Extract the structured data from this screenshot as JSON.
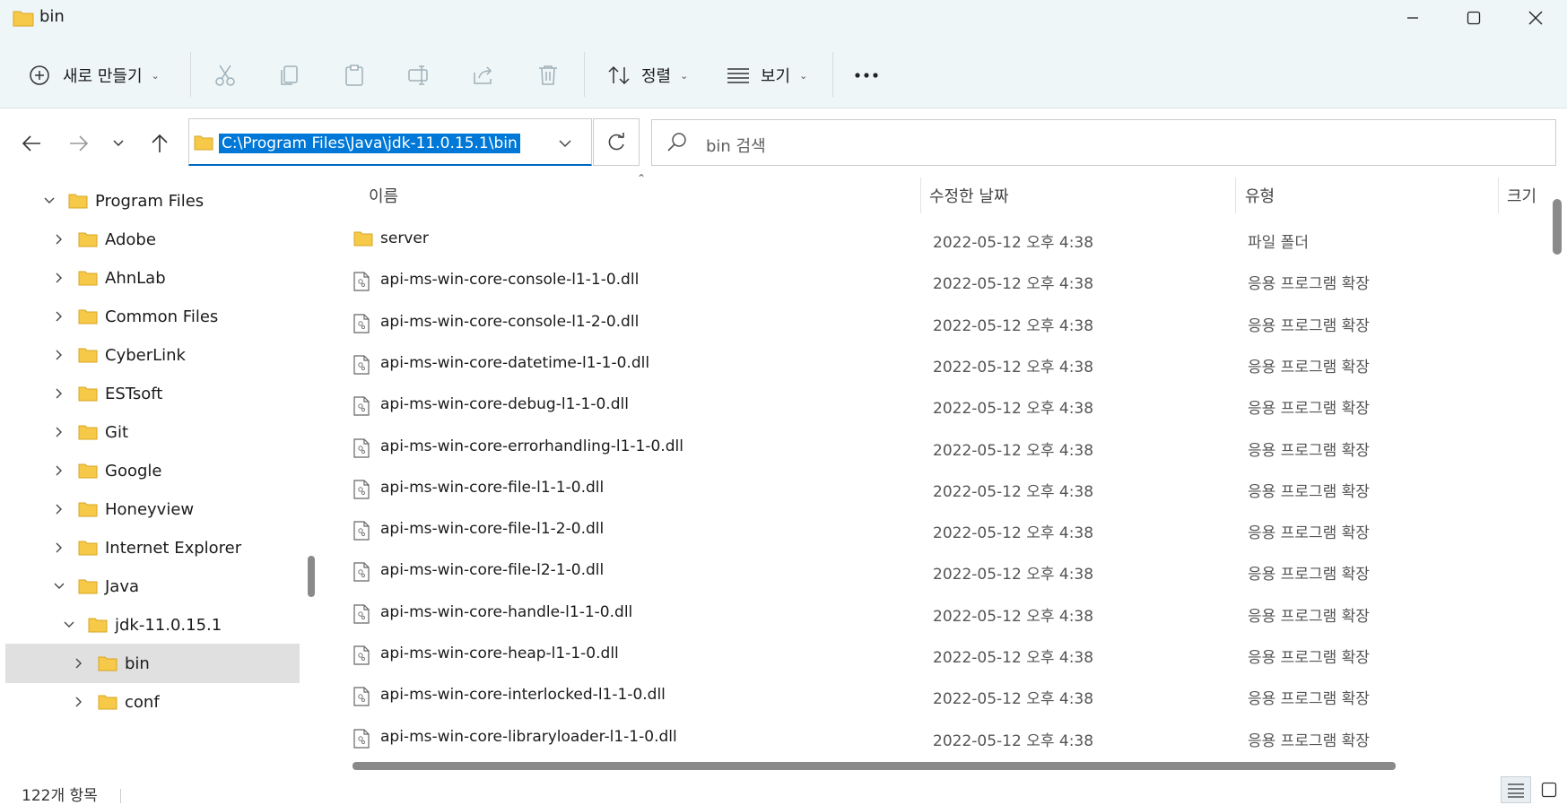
{
  "window": {
    "title": "bin"
  },
  "commandbar": {
    "new_label": "새로 만들기",
    "sort_label": "정렬",
    "view_label": "보기"
  },
  "address": {
    "path": "C:\\Program Files\\Java\\jdk-11.0.15.1\\bin",
    "search_placeholder": "bin 검색"
  },
  "sidebar": {
    "items": [
      {
        "label": "Program Files",
        "state": "expanded"
      },
      {
        "label": "Adobe",
        "state": "collapsed"
      },
      {
        "label": "AhnLab",
        "state": "collapsed"
      },
      {
        "label": "Common Files",
        "state": "collapsed"
      },
      {
        "label": "CyberLink",
        "state": "collapsed"
      },
      {
        "label": "ESTsoft",
        "state": "collapsed"
      },
      {
        "label": "Git",
        "state": "collapsed"
      },
      {
        "label": "Google",
        "state": "collapsed"
      },
      {
        "label": "Honeyview",
        "state": "collapsed"
      },
      {
        "label": "Internet Explorer",
        "state": "collapsed"
      },
      {
        "label": "Java",
        "state": "expanded"
      },
      {
        "label": "jdk-11.0.15.1",
        "state": "expanded"
      },
      {
        "label": "bin",
        "state": "selected"
      },
      {
        "label": "conf",
        "state": "collapsed"
      }
    ]
  },
  "list": {
    "columns": {
      "name": "이름",
      "modified": "수정한 날짜",
      "type": "유형",
      "size": "크기"
    },
    "rows": [
      {
        "name": "server",
        "modified": "2022-05-12 오후 4:38",
        "type": "파일 폴더",
        "kind": "folder"
      },
      {
        "name": "api-ms-win-core-console-l1-1-0.dll",
        "modified": "2022-05-12 오후 4:38",
        "type": "응용 프로그램 확장",
        "kind": "dll"
      },
      {
        "name": "api-ms-win-core-console-l1-2-0.dll",
        "modified": "2022-05-12 오후 4:38",
        "type": "응용 프로그램 확장",
        "kind": "dll"
      },
      {
        "name": "api-ms-win-core-datetime-l1-1-0.dll",
        "modified": "2022-05-12 오후 4:38",
        "type": "응용 프로그램 확장",
        "kind": "dll"
      },
      {
        "name": "api-ms-win-core-debug-l1-1-0.dll",
        "modified": "2022-05-12 오후 4:38",
        "type": "응용 프로그램 확장",
        "kind": "dll"
      },
      {
        "name": "api-ms-win-core-errorhandling-l1-1-0.dll",
        "modified": "2022-05-12 오후 4:38",
        "type": "응용 프로그램 확장",
        "kind": "dll"
      },
      {
        "name": "api-ms-win-core-file-l1-1-0.dll",
        "modified": "2022-05-12 오후 4:38",
        "type": "응용 프로그램 확장",
        "kind": "dll"
      },
      {
        "name": "api-ms-win-core-file-l1-2-0.dll",
        "modified": "2022-05-12 오후 4:38",
        "type": "응용 프로그램 확장",
        "kind": "dll"
      },
      {
        "name": "api-ms-win-core-file-l2-1-0.dll",
        "modified": "2022-05-12 오후 4:38",
        "type": "응용 프로그램 확장",
        "kind": "dll"
      },
      {
        "name": "api-ms-win-core-handle-l1-1-0.dll",
        "modified": "2022-05-12 오후 4:38",
        "type": "응용 프로그램 확장",
        "kind": "dll"
      },
      {
        "name": "api-ms-win-core-heap-l1-1-0.dll",
        "modified": "2022-05-12 오후 4:38",
        "type": "응용 프로그램 확장",
        "kind": "dll"
      },
      {
        "name": "api-ms-win-core-interlocked-l1-1-0.dll",
        "modified": "2022-05-12 오후 4:38",
        "type": "응용 프로그램 확장",
        "kind": "dll"
      },
      {
        "name": "api-ms-win-core-libraryloader-l1-1-0.dll",
        "modified": "2022-05-12 오후 4:38",
        "type": "응용 프로그램 확장",
        "kind": "dll"
      }
    ]
  },
  "status": {
    "item_count": "122개 항목"
  },
  "colors": {
    "accent": "#0078d7",
    "folder": "#f7c948",
    "chrome": "#eef6f8",
    "selected": "#e0e0e0"
  },
  "icons": [
    "folder-icon",
    "add-icon",
    "cut-icon",
    "copy-icon",
    "paste-icon",
    "rename-icon",
    "share-icon",
    "delete-icon",
    "sort-icon",
    "view-icon",
    "more-icon",
    "back-icon",
    "forward-icon",
    "history-icon",
    "up-icon",
    "refresh-icon",
    "search-icon",
    "dll-file-icon",
    "details-view-icon",
    "tiles-view-icon"
  ]
}
